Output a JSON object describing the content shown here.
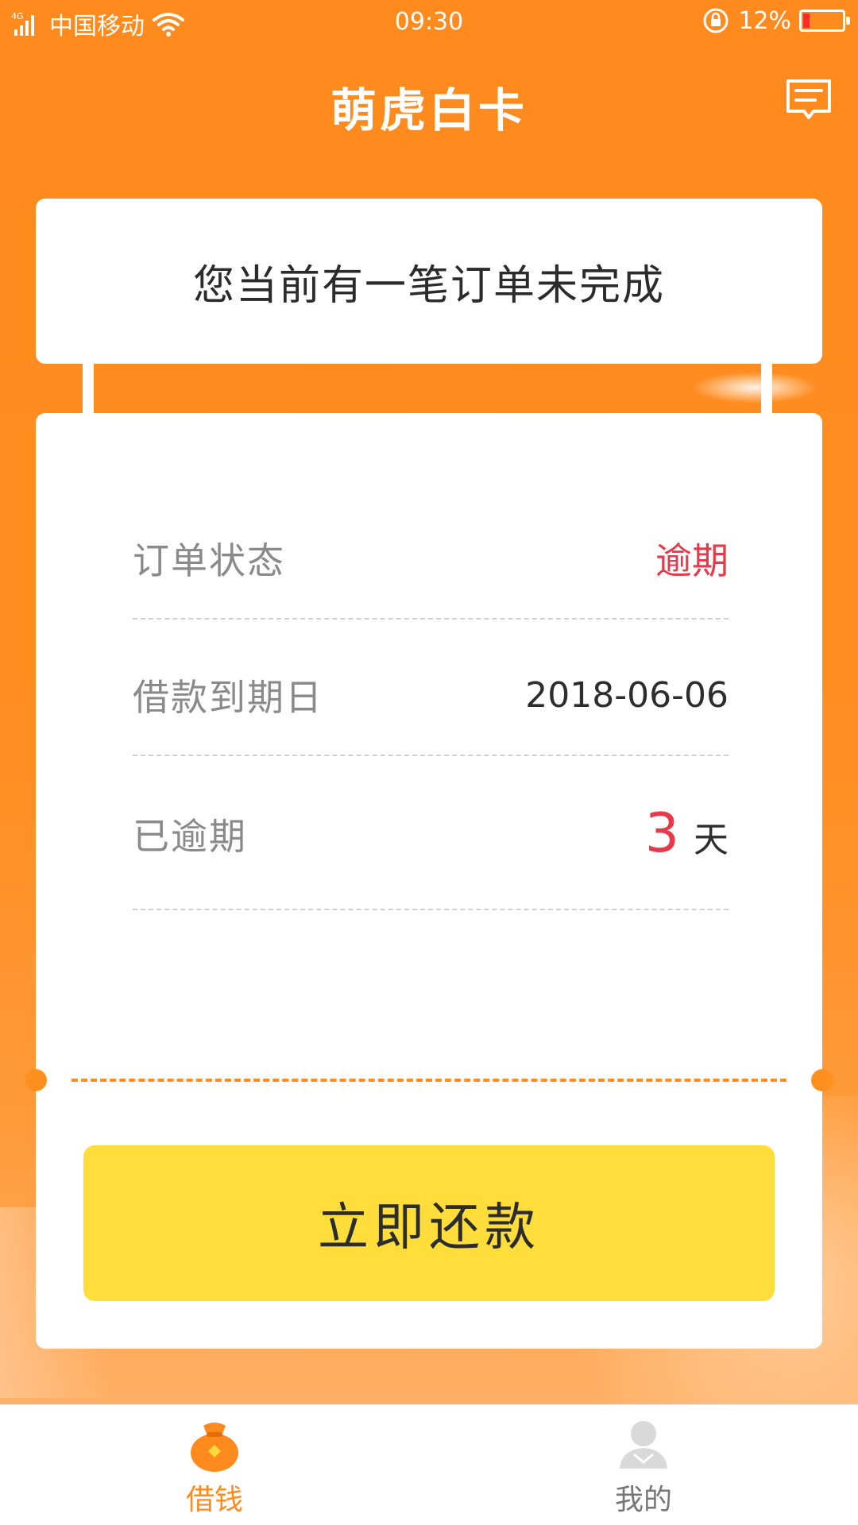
{
  "status_bar": {
    "network": "4G",
    "carrier": "中国移动",
    "time": "09:30",
    "battery": "12%"
  },
  "header": {
    "title": "萌虎白卡"
  },
  "notice": {
    "text": "您当前有一笔订单未完成"
  },
  "order": {
    "rows": [
      {
        "label": "订单状态",
        "value": "逾期"
      },
      {
        "label": "借款到期日",
        "value": "2018-06-06"
      },
      {
        "label": "已逾期",
        "value": "3",
        "unit": "天"
      }
    ]
  },
  "actions": {
    "repay_label": "立即还款"
  },
  "bottom_nav": {
    "items": [
      {
        "label": "借钱",
        "icon": "money-bag-icon",
        "active": true
      },
      {
        "label": "我的",
        "icon": "user-icon",
        "active": false
      }
    ]
  },
  "colors": {
    "brand_orange": "#ff8a1d",
    "alert_red": "#e8394a",
    "button_yellow": "#ffdd3a"
  }
}
